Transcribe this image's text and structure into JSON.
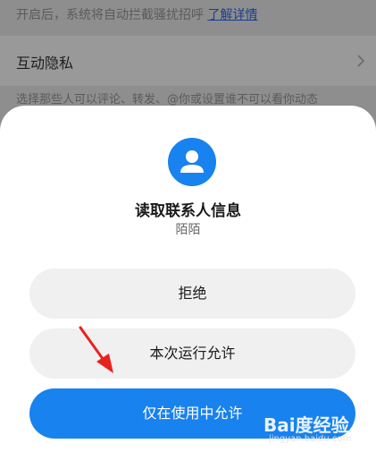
{
  "background": {
    "note_text": "开启后，系统将自动拦截骚扰招呼",
    "note_link": "了解详情",
    "row_label": "互动隐私",
    "row_chevron_icon": "chevron-right-icon",
    "description": "选择那些人可以评论、转发、@你或设置谁不可以看你动态"
  },
  "dialog": {
    "icon": "contact-person-icon",
    "title": "读取联系人信息",
    "app_name": "陌陌",
    "buttons": {
      "deny": "拒绝",
      "allow_once": "本次运行允许",
      "allow_while_using": "仅在使用中允许"
    }
  },
  "annotation": {
    "arrow_color": "#e8231f"
  },
  "watermark": {
    "text": "Bai度经验",
    "url": "jingyan.baidu.com"
  },
  "colors": {
    "accent": "#1882ee",
    "secondary_button": "#f0f0f0"
  }
}
